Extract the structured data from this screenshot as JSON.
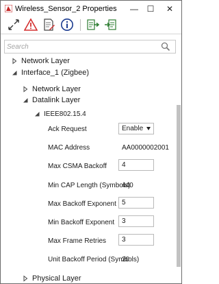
{
  "window": {
    "title": "Wireless_Sensor_2 Properties",
    "minimize_glyph": "—",
    "maximize_glyph": "☐",
    "close_glyph": "✕"
  },
  "toolbar": {
    "icons": [
      "resize-arrows-icon",
      "warning-icon",
      "note-icon",
      "info-icon",
      "export-icon",
      "import-icon"
    ]
  },
  "search": {
    "placeholder": "Search"
  },
  "tree": {
    "network_layer_top": "Network Layer",
    "interface": "Interface_1 (Zigbee)",
    "network_layer_child": "Network Layer",
    "datalink_layer": "Datalink Layer",
    "ieee": "IEEE802.15.4",
    "physical_layer": "Physical Layer"
  },
  "properties": [
    {
      "label": "Ack Request",
      "kind": "select",
      "value": "Enable"
    },
    {
      "label": "MAC Address",
      "kind": "text",
      "value": "AA0000002001"
    },
    {
      "label": "Max CSMA Backoff",
      "kind": "input",
      "value": "4"
    },
    {
      "label": "Min CAP Length (Symbols)",
      "kind": "text",
      "value": "440"
    },
    {
      "label": "Max Backoff Exponent",
      "kind": "input",
      "value": "5"
    },
    {
      "label": "Min Backoff Exponent",
      "kind": "input",
      "value": "3"
    },
    {
      "label": "Max Frame Retries",
      "kind": "input",
      "value": "3"
    },
    {
      "label": "Unit Backoff Period (Symbols)",
      "kind": "text",
      "value": "20"
    }
  ],
  "colors": {
    "accent_red": "#d32f2f",
    "accent_green": "#2e7d32",
    "info_blue": "#1a3a8f"
  }
}
